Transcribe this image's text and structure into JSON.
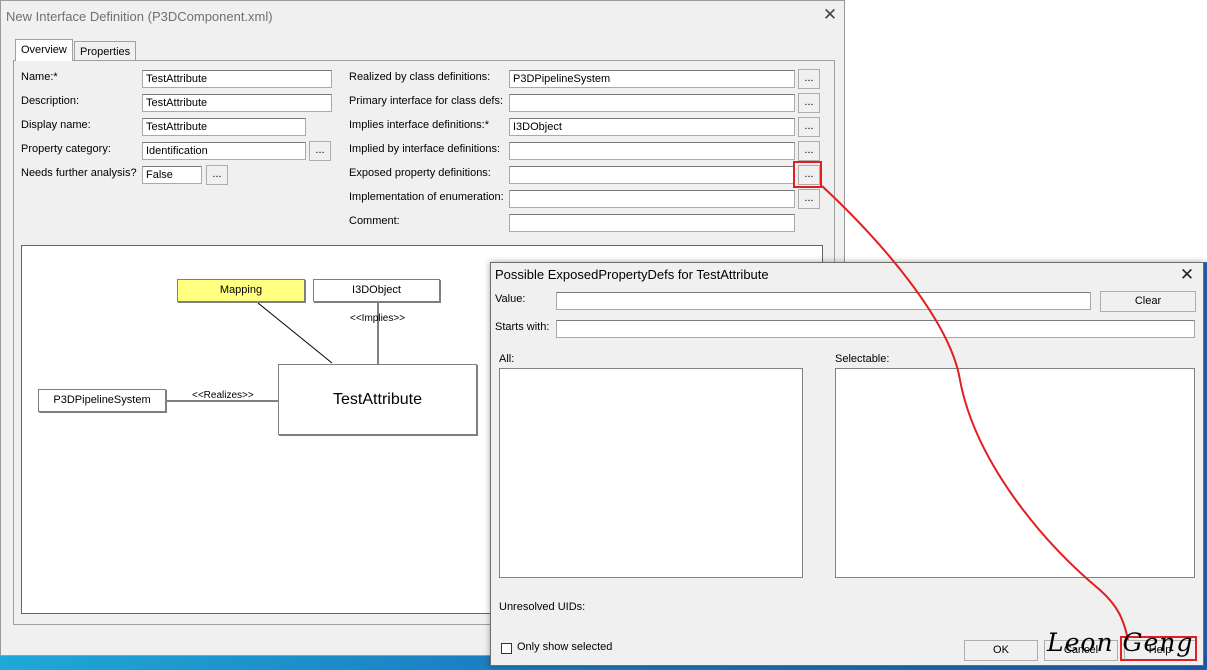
{
  "window": {
    "title": "New Interface Definition (P3DComponent.xml)",
    "close_glyph": "✕"
  },
  "tabs": [
    {
      "label": "Overview"
    },
    {
      "label": "Properties"
    }
  ],
  "form_left": {
    "name_label": "Name:*",
    "name_value": "TestAttribute",
    "description_label": "Description:",
    "description_value": "TestAttribute",
    "display_name_label": "Display name:",
    "display_name_value": "TestAttribute",
    "property_category_label": "Property category:",
    "property_category_value": "Identification",
    "needs_analysis_label": "Needs further analysis?",
    "needs_analysis_value": "False",
    "browse_label": "..."
  },
  "form_right": {
    "realized_label": "Realized by class definitions:",
    "realized_value": "P3DPipelineSystem",
    "primary_label": "Primary interface for class defs:",
    "primary_value": "",
    "implies_label": "Implies interface definitions:*",
    "implies_value": "I3DObject",
    "implied_by_label": "Implied by interface definitions:",
    "implied_by_value": "",
    "exposed_label": "Exposed property definitions:",
    "exposed_value": "",
    "enumeration_label": "Implementation of enumeration:",
    "enumeration_value": "",
    "comment_label": "Comment:",
    "comment_value": ""
  },
  "diagram": {
    "mapping_node": "Mapping",
    "i3d_node": "I3DObject",
    "implies_label": "<<Implies>>",
    "main_node": "TestAttribute",
    "realizes_label": "<<Realizes>>",
    "p3d_node": "P3DPipelineSystem",
    "mapping_color": "#ffff80"
  },
  "dialog": {
    "title": "Possible ExposedPropertyDefs for TestAttribute",
    "value_label": "Value:",
    "value_text": "",
    "clear_button": "Clear",
    "starts_with_label": "Starts with:",
    "starts_with_text": "",
    "all_label": "All:",
    "selectable_label": "Selectable:",
    "unresolved_label": "Unresolved UIDs:",
    "only_show_selected_label": "Only show selected",
    "ok_button": "OK",
    "cancel_button": "Cancel",
    "help_button": "Help"
  },
  "annotation": {
    "color": "#e02020",
    "signature": "Leon Geng"
  }
}
